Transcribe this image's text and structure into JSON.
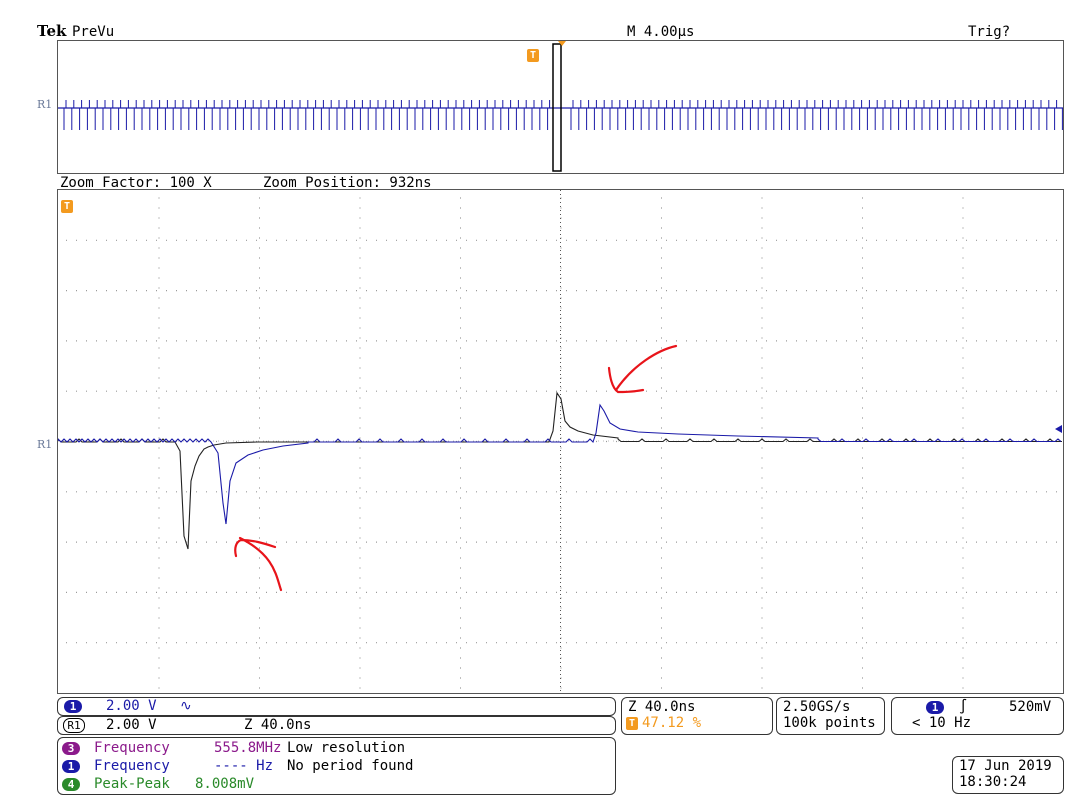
{
  "header": {
    "brand": "Tek",
    "mode": "PreVu",
    "timebase": "M 4.00µs",
    "trigger_status": "Trig?"
  },
  "zoom": {
    "factor": "Zoom Factor: 100 X",
    "position": "Zoom Position: 932ns"
  },
  "ref_label": "R1",
  "trigger_marker": "T",
  "channels": {
    "ch1": {
      "num": "1",
      "scale": "2.00 V",
      "coupling_symbol": "∿"
    },
    "r1": {
      "num": "R1",
      "scale": "2.00 V",
      "zoom": "Z 40.0ns"
    }
  },
  "measurements": [
    {
      "num": "3",
      "name": "Frequency",
      "value": "555.8MHz",
      "note": "Low resolution"
    },
    {
      "num": "1",
      "name": "Frequency",
      "value": "---- Hz",
      "note": "No period found"
    },
    {
      "num": "4",
      "name": "Peak-Peak",
      "value": "8.008mV",
      "note": ""
    }
  ],
  "horizontal": {
    "zoom": "Z 40.0ns",
    "trig_pos": "47.12 %"
  },
  "acquisition": {
    "rate": "2.50GS/s",
    "points": "100k points"
  },
  "trigger": {
    "source": "1",
    "slope_symbol": "∫",
    "level": "520mV",
    "freq": "< 10 Hz"
  },
  "datetime": {
    "date": "17 Jun 2019",
    "time": "18:30:24"
  },
  "colors": {
    "ch1": "#1a1aa8",
    "ch3": "#8b1a8b",
    "ch4": "#2a8a2a",
    "trigger": "#f39a1f",
    "annotation": "#e8141a"
  }
}
